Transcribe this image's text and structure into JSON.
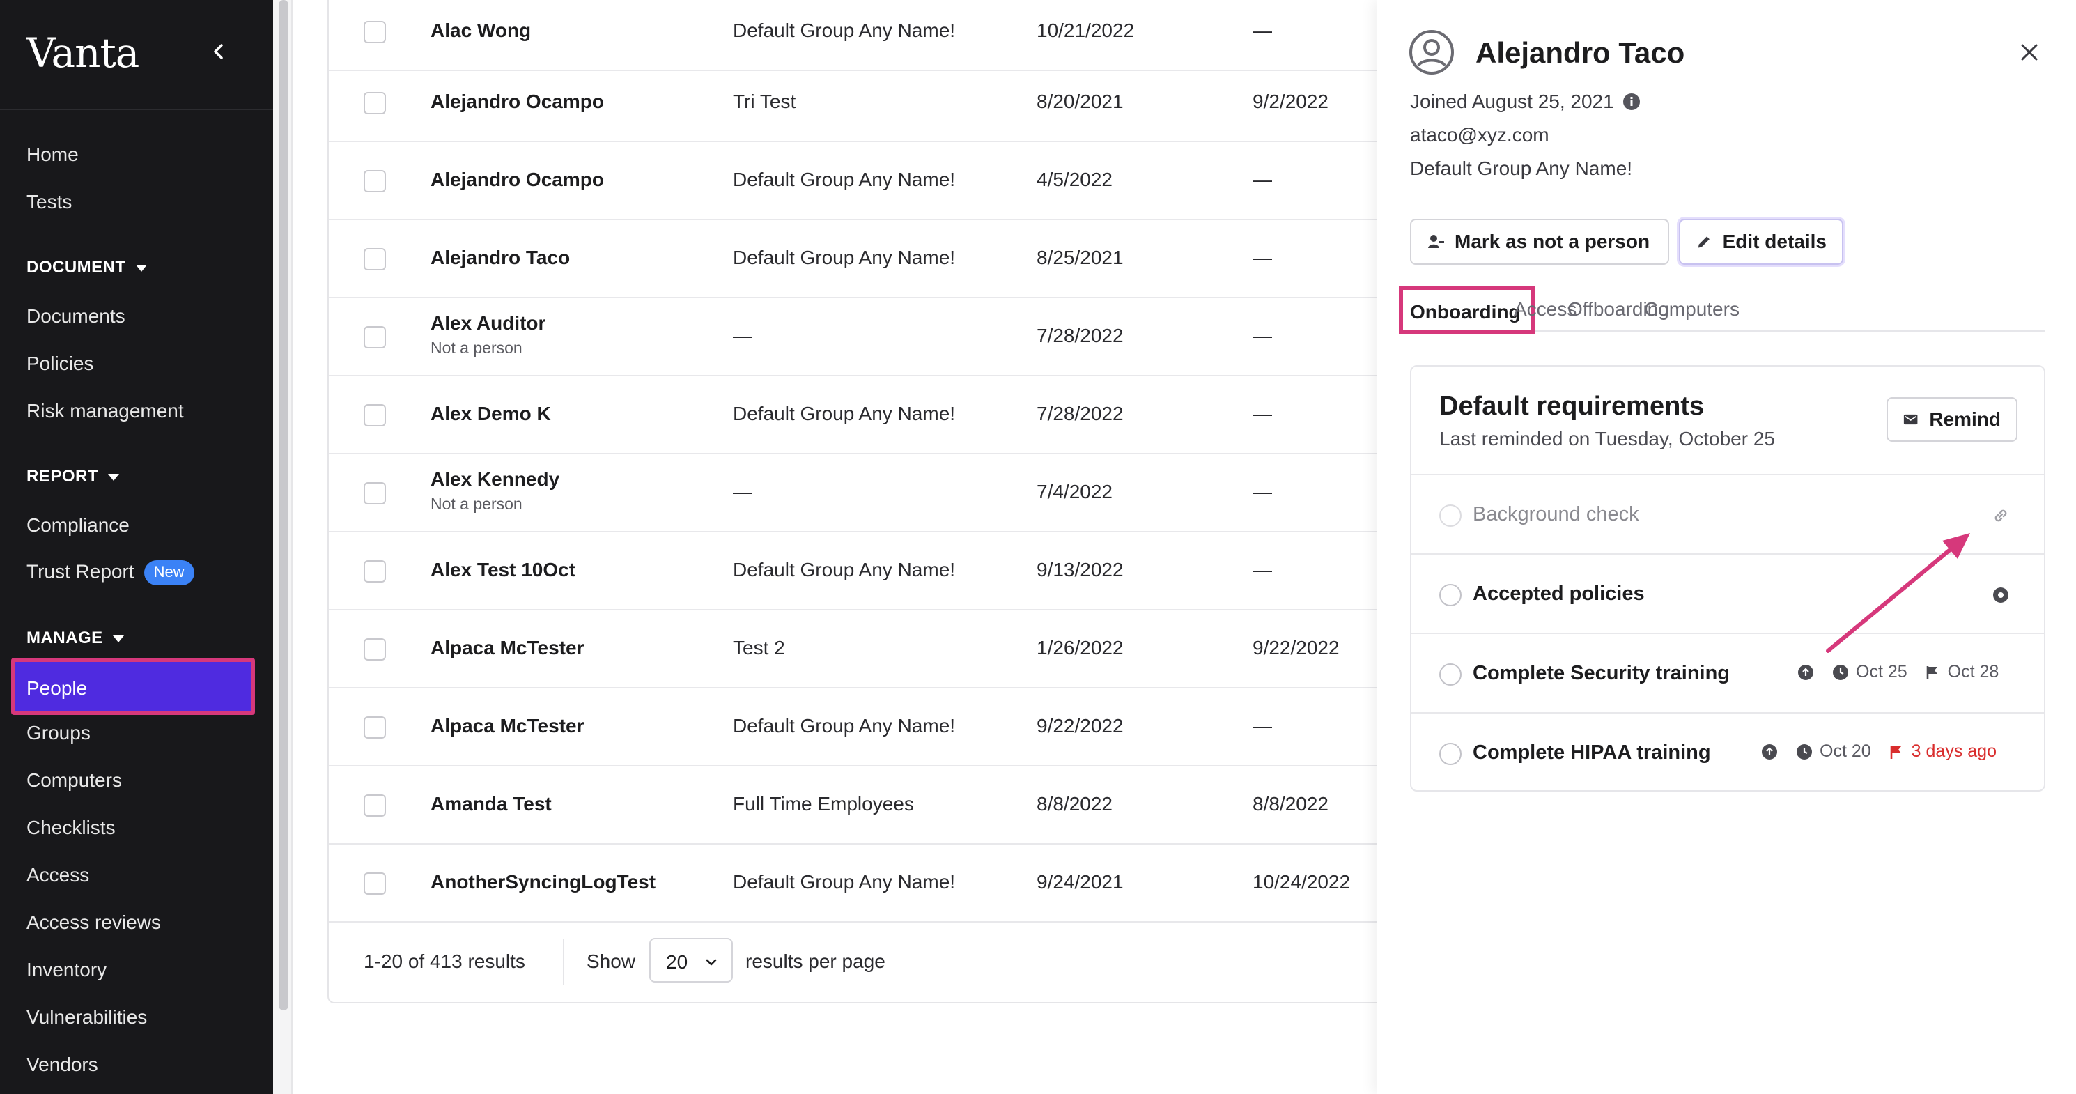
{
  "sidebar": {
    "brand": "Vanta",
    "items": {
      "home": "Home",
      "tests": "Tests",
      "document_section": "DOCUMENT",
      "documents": "Documents",
      "policies": "Policies",
      "risk_management": "Risk management",
      "report_section": "REPORT",
      "compliance": "Compliance",
      "trust_report": "Trust Report",
      "trust_report_badge": "New",
      "manage_section": "MANAGE",
      "people": "People",
      "groups": "Groups",
      "computers": "Computers",
      "checklists": "Checklists",
      "access": "Access",
      "access_reviews": "Access reviews",
      "inventory": "Inventory",
      "vulnerabilities": "Vulnerabilities",
      "vendors": "Vendors"
    }
  },
  "table": {
    "rows": [
      {
        "name": "Alac Wong",
        "sub": "",
        "group": "Default Group Any Name!",
        "start": "10/21/2022",
        "end": "—"
      },
      {
        "name": "Alejandro Ocampo",
        "sub": "",
        "group": "Tri Test",
        "start": "8/20/2021",
        "end": "9/2/2022"
      },
      {
        "name": "Alejandro Ocampo",
        "sub": "",
        "group": "Default Group Any Name!",
        "start": "4/5/2022",
        "end": "—"
      },
      {
        "name": "Alejandro Taco",
        "sub": "",
        "group": "Default Group Any Name!",
        "start": "8/25/2021",
        "end": "—"
      },
      {
        "name": "Alex Auditor",
        "sub": "Not a person",
        "group": "—",
        "start": "7/28/2022",
        "end": "—"
      },
      {
        "name": "Alex Demo K",
        "sub": "",
        "group": "Default Group Any Name!",
        "start": "7/28/2022",
        "end": "—"
      },
      {
        "name": "Alex Kennedy",
        "sub": "Not a person",
        "group": "—",
        "start": "7/4/2022",
        "end": "—"
      },
      {
        "name": "Alex Test 10Oct",
        "sub": "",
        "group": "Default Group Any Name!",
        "start": "9/13/2022",
        "end": "—"
      },
      {
        "name": "Alpaca McTester",
        "sub": "",
        "group": "Test 2",
        "start": "1/26/2022",
        "end": "9/22/2022"
      },
      {
        "name": "Alpaca McTester",
        "sub": "",
        "group": "Default Group Any Name!",
        "start": "9/22/2022",
        "end": "—"
      },
      {
        "name": "Amanda Test",
        "sub": "",
        "group": "Full Time Employees",
        "start": "8/8/2022",
        "end": "8/8/2022"
      },
      {
        "name": "AnotherSyncingLogTest",
        "sub": "",
        "group": "Default Group Any Name!",
        "start": "9/24/2021",
        "end": "10/24/2022"
      }
    ],
    "pager": {
      "count": "1-20 of 413 results",
      "show": "Show",
      "page_size": "20",
      "per_page": "results per page"
    }
  },
  "panel": {
    "name": "Alejandro Taco",
    "joined": "Joined August 25, 2021",
    "email": "ataco@xyz.com",
    "group": "Default Group Any Name!",
    "mark_button": "Mark as not a person",
    "edit_button": "Edit details",
    "tabs": [
      "Onboarding",
      "Access",
      "Offboarding",
      "Computers"
    ],
    "card": {
      "title": "Default requirements",
      "subtitle": "Last reminded on Tuesday, October 25",
      "remind": "Remind",
      "requirements": [
        {
          "label": "Background check"
        },
        {
          "label": "Accepted policies"
        },
        {
          "label": "Complete Security training",
          "date": "Oct 25",
          "due": "Oct 28"
        },
        {
          "label": "Complete HIPAA training",
          "date": "Oct 20",
          "due": "3 days ago"
        }
      ]
    }
  },
  "colors": {
    "sidebar_bg": "#18181b",
    "active_nav": "#4f2be0",
    "highlight": "#d6387b",
    "badge": "#3b82f6",
    "overdue": "#d92d2d"
  }
}
